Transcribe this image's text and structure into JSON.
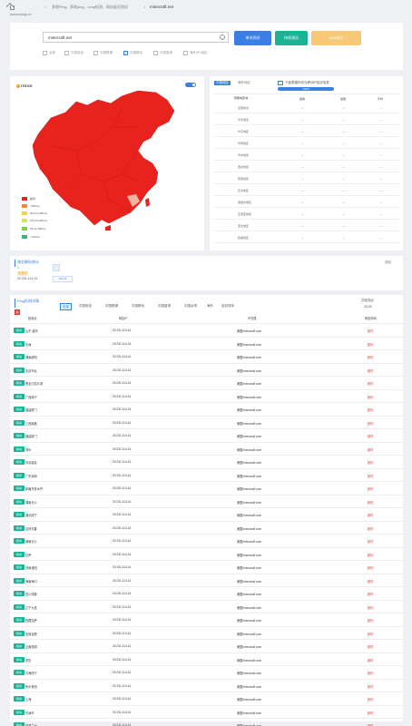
{
  "header": {
    "site": "www.itdog.cn",
    "crumb1": "多地Ping、多地ping、icmp检测、网站延迟测试",
    "crumb_sep": "/",
    "target": "minecraft.net"
  },
  "search": {
    "value": "minecraft.net",
    "btn_single": "单次测试",
    "btn_continuous": "持续测试",
    "btn_ipv6": "ipv6测试",
    "options": [
      {
        "label": "全部",
        "checked": false
      },
      {
        "label": "中国电信",
        "checked": false
      },
      {
        "label": "中国联通",
        "checked": false
      },
      {
        "label": "中国移动",
        "checked": true
      },
      {
        "label": "中国香港",
        "checked": false
      },
      {
        "label": "海外(IP)地区",
        "checked": false
      }
    ]
  },
  "map": {
    "logo": "ITDOG",
    "legend": [
      {
        "label": "超时",
        "color": "#e8221d"
      },
      {
        "label": ">250ms",
        "color": "#f08c38"
      },
      {
        "label": "201ms-250ms",
        "color": "#f4d34a"
      },
      {
        "label": "151ms-200ms",
        "color": "#cde65a"
      },
      {
        "label": "51ms-150ms",
        "color": "#7cd248"
      },
      {
        "label": "<=50ms",
        "color": "#3cb371"
      }
    ],
    "fill": "#e8221d"
  },
  "region_table": {
    "tabs": [
      "中国地区",
      "海外地区"
    ],
    "note": "下面表格的均为移动IP延迟信息",
    "progress_label": "100%",
    "headers": [
      "所属地区域",
      "最快",
      "最慢",
      "平均"
    ],
    "rows": [
      [
        "全国综合",
        "—",
        "—",
        "—"
      ],
      [
        "华北地区",
        "—",
        "—",
        "—"
      ],
      [
        "华东地区",
        "—",
        "—",
        "—"
      ],
      [
        "华南地区",
        "—",
        "—",
        "—"
      ],
      [
        "华中地区",
        "—",
        "—",
        "—"
      ],
      [
        "西北地区",
        "—",
        "—",
        "—"
      ],
      [
        "西南地区",
        "—",
        "—",
        "—"
      ],
      [
        "东北地区",
        "—",
        "—",
        "—"
      ],
      [
        "港澳台地区",
        "—",
        "—",
        "—"
      ],
      [
        "东南亚地区",
        "—",
        "—",
        "—"
      ],
      [
        "亚太地区",
        "—",
        "—",
        "—"
      ],
      [
        "欧美地区",
        "—",
        "—",
        "—"
      ]
    ]
  },
  "resolve": {
    "title": "域名解析统计",
    "count": "1",
    "right_label": "收起",
    "ip_badge": "负载IP",
    "ip_value": "20.231.114.14",
    "ip_count": "100.00"
  },
  "detail": {
    "title": "Ping检测详情",
    "badge": "超",
    "filters": [
      "全部",
      "中国电信",
      "中国联通",
      "中国移动",
      "中国香港",
      "中国台湾",
      "海外",
      "延迟排序"
    ],
    "right_text": "共检测点",
    "right_count": "33,00",
    "headers": [
      "检测点",
      "响应IP",
      "IP归属",
      "响应时间"
    ],
    "rows": [
      {
        "tag": "移动",
        "node": "山东·潍坊",
        "ip": "20.231.114.14",
        "loc": "美国/microsoft.com",
        "time": "超时"
      },
      {
        "tag": "移动",
        "node": "天津",
        "ip": "20.231.114.14",
        "loc": "美国/microsoft.com",
        "time": "超时"
      },
      {
        "tag": "移动",
        "node": "湖南邵阳",
        "ip": "20.231.114.14",
        "loc": "美国/microsoft.com",
        "time": "超时"
      },
      {
        "tag": "移动",
        "node": "北京市北",
        "ip": "20.231.114.14",
        "loc": "美国/microsoft.com",
        "time": "超时"
      },
      {
        "tag": "移动",
        "node": "黑龙江哈尔滨",
        "ip": "20.231.114.14",
        "loc": "美国/microsoft.com",
        "time": "超时"
      },
      {
        "tag": "移动",
        "node": "广西南宁",
        "ip": "20.231.114.14",
        "loc": "美国/microsoft.com",
        "time": "超时"
      },
      {
        "tag": "移动",
        "node": "福建厦门",
        "ip": "20.231.114.14",
        "loc": "美国/microsoft.com",
        "time": "超时"
      },
      {
        "tag": "移动",
        "node": "江西南昌",
        "ip": "20.231.114.14",
        "loc": "美国/microsoft.com",
        "time": "超时"
      },
      {
        "tag": "移动",
        "node": "福建厦门",
        "ip": "20.231.114.14",
        "loc": "美国/microsoft.com",
        "time": "超时"
      },
      {
        "tag": "移动",
        "node": "郑州",
        "ip": "20.231.114.14",
        "loc": "美国/microsoft.com",
        "time": "超时"
      },
      {
        "tag": "移动",
        "node": "河北保定",
        "ip": "20.231.114.14",
        "loc": "美国/microsoft.com",
        "time": "超时"
      },
      {
        "tag": "移动",
        "node": "广东深圳",
        "ip": "20.231.114.14",
        "loc": "美国/microsoft.com",
        "time": "超时"
      },
      {
        "tag": "移动",
        "node": "新疆乌鲁木齐",
        "ip": "20.231.114.14",
        "loc": "美国/microsoft.com",
        "time": "超时"
      },
      {
        "tag": "移动",
        "node": "湖南长沙",
        "ip": "20.231.114.14",
        "loc": "美国/microsoft.com",
        "time": "超时"
      },
      {
        "tag": "移动",
        "node": "湖北咸宁",
        "ip": "20.231.114.14",
        "loc": "美国/microsoft.com",
        "time": "超时"
      },
      {
        "tag": "移动",
        "node": "吉林长春",
        "ip": "20.231.114.14",
        "loc": "美国/microsoft.com",
        "time": "超时"
      },
      {
        "tag": "移动",
        "node": "湖南长沙",
        "ip": "20.231.114.14",
        "loc": "美国/microsoft.com",
        "time": "超时"
      },
      {
        "tag": "移动",
        "node": "拉萨",
        "ip": "20.231.114.14",
        "loc": "美国/microsoft.com",
        "time": "超时"
      },
      {
        "tag": "移动",
        "node": "河南洛阳",
        "ip": "20.231.114.14",
        "loc": "美国/microsoft.com",
        "time": "超时"
      },
      {
        "tag": "移动",
        "node": "海南海口",
        "ip": "20.231.114.14",
        "loc": "美国/microsoft.com",
        "time": "超时"
      },
      {
        "tag": "移动",
        "node": "四川成都",
        "ip": "20.231.114.14",
        "loc": "美国/microsoft.com",
        "time": "超时"
      },
      {
        "tag": "移动",
        "node": "辽宁大连",
        "ip": "20.231.114.14",
        "loc": "美国/microsoft.com",
        "time": "超时"
      },
      {
        "tag": "移动",
        "node": "西藏拉萨",
        "ip": "20.231.114.14",
        "loc": "美国/microsoft.com",
        "time": "超时"
      },
      {
        "tag": "移动",
        "node": "安徽合肥",
        "ip": "20.231.114.14",
        "loc": "美国/microsoft.com",
        "time": "超时"
      },
      {
        "tag": "移动",
        "node": "云南昆明",
        "ip": "20.231.114.14",
        "loc": "美国/microsoft.com",
        "time": "超时"
      },
      {
        "tag": "移动",
        "node": "重庆",
        "ip": "20.231.114.14",
        "loc": "美国/microsoft.com",
        "time": "超时"
      },
      {
        "tag": "移动",
        "node": "青海西宁",
        "ip": "20.231.114.14",
        "loc": "美国/microsoft.com",
        "time": "超时"
      },
      {
        "tag": "移动",
        "node": "贵州贵阳",
        "ip": "20.231.114.14",
        "loc": "美国/microsoft.com",
        "time": "超时"
      },
      {
        "tag": "移动",
        "node": "上海",
        "ip": "20.231.114.14",
        "loc": "美国/microsoft.com",
        "time": "超时"
      },
      {
        "tag": "移动",
        "node": "天津市",
        "ip": "20.231.114.14",
        "loc": "美国/microsoft.com",
        "time": "超时"
      },
      {
        "tag": "移动",
        "node": "甘肃兰州",
        "ip": "20.231.114.14",
        "loc": "美国/microsoft.com",
        "time": "超时"
      }
    ]
  }
}
